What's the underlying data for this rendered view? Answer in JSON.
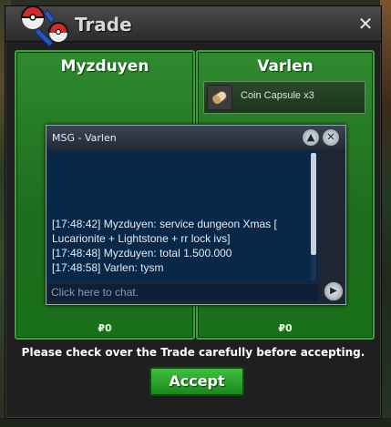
{
  "window": {
    "title": "Trade",
    "close_glyph": "✕"
  },
  "left_panel": {
    "name": "Myzduyen",
    "money": "₽0"
  },
  "right_panel": {
    "name": "Varlen",
    "items": [
      {
        "label": "Coin Capsule x3",
        "icon": "coin-capsule-icon"
      }
    ],
    "money": "₽0"
  },
  "chat": {
    "title": "MSG - Varlen",
    "lines": [
      "[17:48:42] Myzduyen: service dungeon Xmas [ Lucarionite + Lightstone + rr lock ivs]",
      "[17:48:48] Myzduyen: total 1.500.000",
      "[17:48:58] Varlen: tysm"
    ],
    "input_placeholder": "Click here to chat."
  },
  "notice": "Please check over the Trade carefully before accepting.",
  "accept_label": "Accept",
  "colors": {
    "panel_green": "#1e6e1e",
    "accept_green": "#2ea82e",
    "chat_bg": "#08284a"
  }
}
